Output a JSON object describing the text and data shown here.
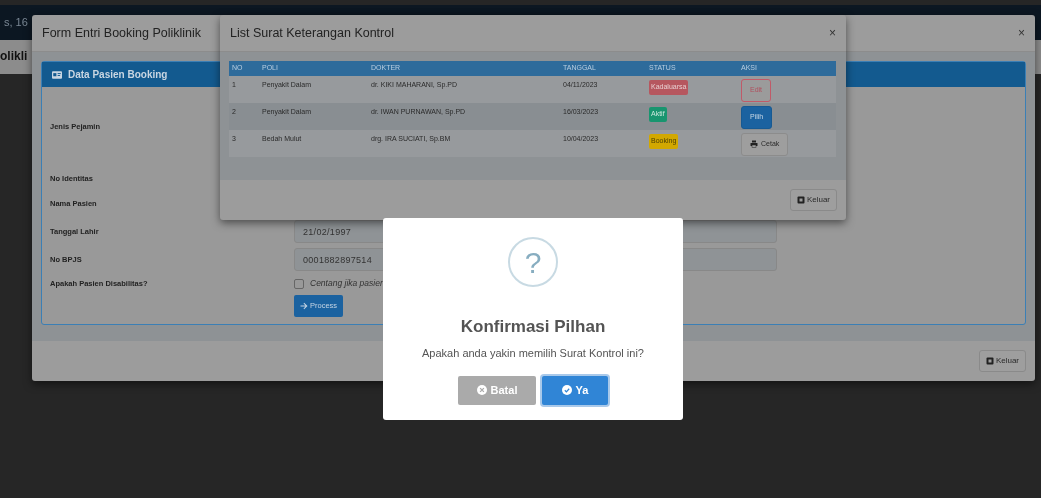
{
  "background": {
    "header_text": "s, 16",
    "page_title": "olikli"
  },
  "form_modal": {
    "title": "Form Entri Booking Poliklinik",
    "close": "×",
    "card_title": "Data Pasien Booking",
    "fields": [
      {
        "label": "Jenis Pejamin",
        "kind": "hidden"
      },
      {
        "label": "No Identitas",
        "kind": "hidden"
      },
      {
        "label": "Nama Pasien",
        "kind": "hidden"
      },
      {
        "label": "Tanggal Lahir",
        "kind": "input",
        "value": "21/02/1997"
      },
      {
        "label": "No BPJS",
        "kind": "input",
        "value": "0001882897514"
      },
      {
        "label": "Apakah Pasien Disabilitas?",
        "kind": "checkbox",
        "checked": false,
        "text": "Centang jika pasien"
      }
    ],
    "process_button": "Process",
    "footer_button": "Keluar"
  },
  "list_modal": {
    "title": "List Surat Keterangan Kontrol",
    "close": "×",
    "columns": [
      "NO",
      "POLI",
      "DOKTER",
      "TANGGAL",
      "STATUS",
      "AKSI"
    ],
    "rows": [
      {
        "no": "1",
        "poli": "Penyakit Dalam",
        "dokter": "dr. KIKI MAHARANI, Sp.PD",
        "tanggal": "04/11/2023",
        "status": {
          "label": "Kadaluarsa",
          "kind": "expired"
        },
        "action": {
          "label": "Edit",
          "kind": "edit"
        }
      },
      {
        "no": "2",
        "poli": "Penyakit Dalam",
        "dokter": "dr. IWAN PURNAWAN, Sp.PD",
        "tanggal": "16/03/2023",
        "status": {
          "label": "Aktif",
          "kind": "active"
        },
        "action": {
          "label": "Pilih",
          "kind": "select"
        }
      },
      {
        "no": "3",
        "poli": "Bedah Mulut",
        "dokter": "drg. IRA SUCIATI, Sp.BM",
        "tanggal": "10/04/2023",
        "status": {
          "label": "Booking",
          "kind": "booking"
        },
        "action": {
          "label": "Cetak",
          "kind": "print"
        }
      }
    ],
    "footer_button": "Keluar"
  },
  "confirm": {
    "icon": "?",
    "title": "Konfirmasi Pilhan",
    "message": "Apakah anda yakin memilih Surat Kontrol ini?",
    "buttons": [
      {
        "label": "Batal",
        "kind": "cancel"
      },
      {
        "label": "Ya",
        "kind": "confirm"
      }
    ]
  }
}
